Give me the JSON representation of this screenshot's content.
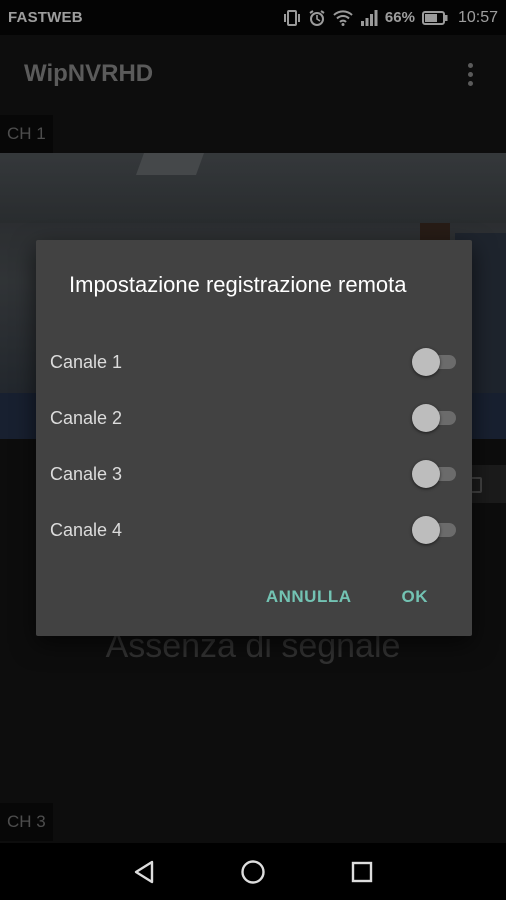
{
  "status_bar": {
    "carrier": "FASTWEB",
    "battery": "66%",
    "time": "10:57",
    "icons": [
      "vibrate-icon",
      "alarm-icon",
      "wifi-icon",
      "signal-icon",
      "battery-icon"
    ]
  },
  "app_bar": {
    "title": "WipNVRHD",
    "overflow_icon": "more-vert-icon"
  },
  "channels": {
    "ch1_label": "CH 1",
    "ch3_label": "CH 3",
    "no_signal": "Assenza di segnale"
  },
  "dialog": {
    "title": "Impostazione registrazione remota",
    "switches": [
      {
        "label": "Canale 1",
        "checked": false
      },
      {
        "label": "Canale 2",
        "checked": false
      },
      {
        "label": "Canale 3",
        "checked": false
      },
      {
        "label": "Canale 4",
        "checked": false
      }
    ],
    "cancel_label": "ANNULLA",
    "ok_label": "OK"
  },
  "nav_bar": {
    "icons": [
      "back-icon",
      "home-icon",
      "recents-icon"
    ]
  },
  "colors": {
    "accent": "#73c3b3",
    "dialog_bg": "#424242",
    "switch_thumb_off": "#bdbdbd"
  }
}
